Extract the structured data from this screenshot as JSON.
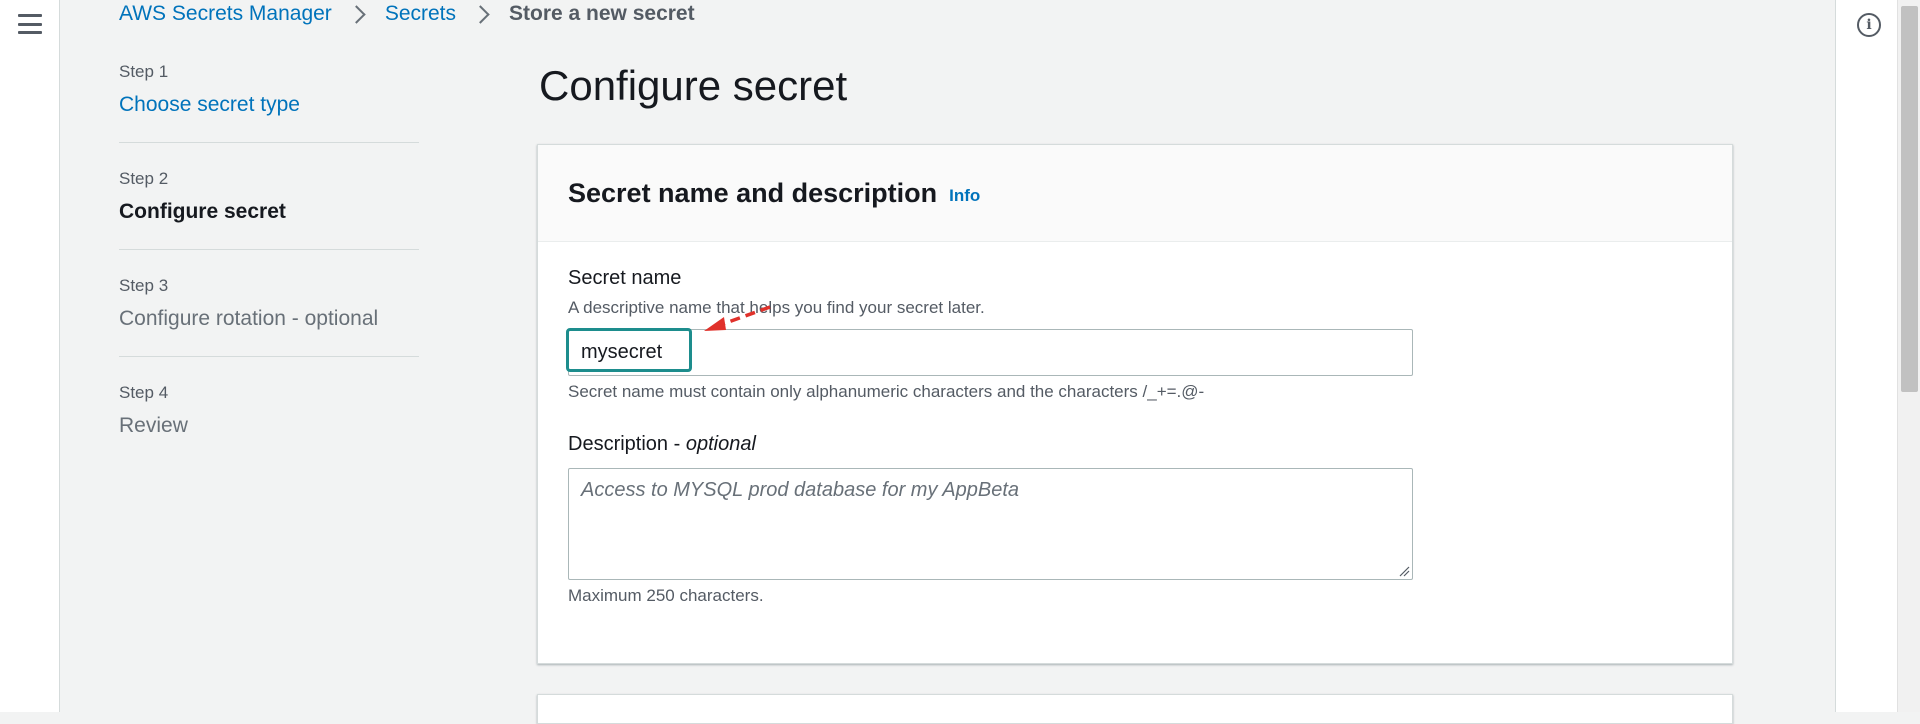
{
  "breadcrumb": {
    "items": [
      "AWS Secrets Manager",
      "Secrets"
    ],
    "current": "Store a new secret"
  },
  "steps": [
    {
      "number": "Step 1",
      "title": "Choose secret type"
    },
    {
      "number": "Step 2",
      "title": "Configure secret"
    },
    {
      "number": "Step 3",
      "title": "Configure rotation - optional"
    },
    {
      "number": "Step 4",
      "title": "Review"
    }
  ],
  "page": {
    "title": "Configure secret"
  },
  "card": {
    "title": "Secret name and description",
    "info_label": "Info",
    "secret_name": {
      "label": "Secret name",
      "description": "A descriptive name that helps you find your secret later.",
      "value": "mysecret",
      "constraint": "Secret name must contain only alphanumeric characters and the characters /_+=.@-"
    },
    "description": {
      "label": "Description",
      "optional_suffix": "optional",
      "separator": " - ",
      "placeholder": "Access to MYSQL prod database for my AppBeta",
      "constraint": "Maximum 250 characters."
    }
  },
  "colors": {
    "link": "#0073bb",
    "focus": "#1d8d8d",
    "annotation_arrow": "#e0312b",
    "background": "#f2f3f3"
  },
  "icons": {
    "menu": "hamburger-menu-icon",
    "help": "info-circle-icon",
    "breadcrumb_separator": "chevron-right-icon",
    "annotation": "red-dashed-arrow-icon",
    "resize": "resize-grip-icon"
  }
}
